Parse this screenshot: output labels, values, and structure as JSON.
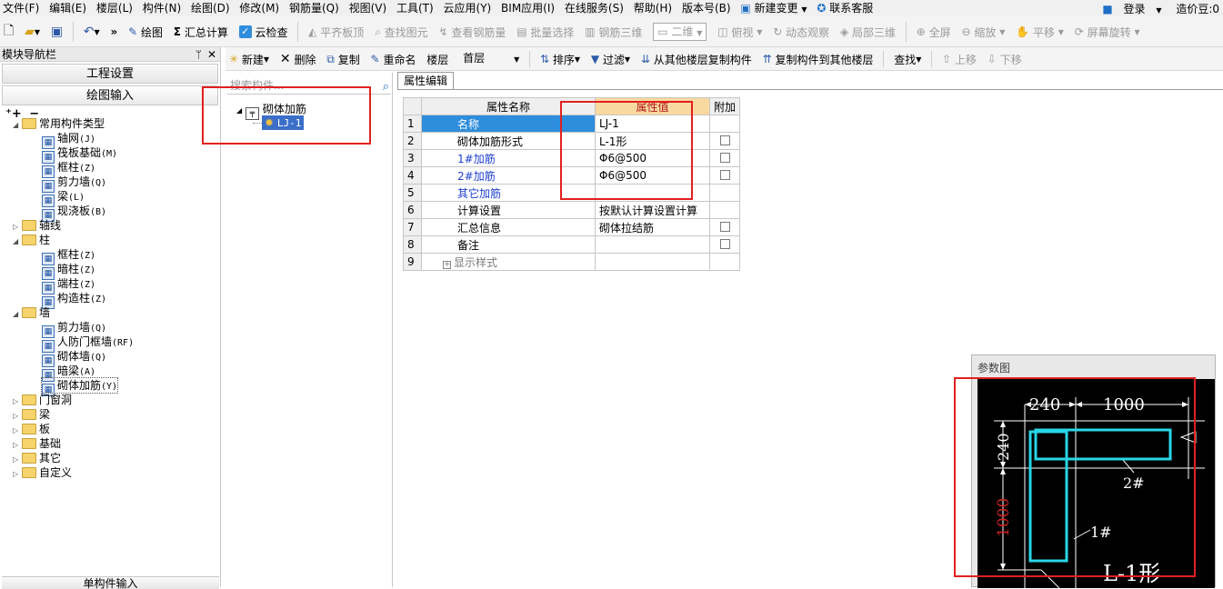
{
  "menubar": {
    "items": [
      "文件(F)",
      "编辑(E)",
      "楼层(L)",
      "构件(N)",
      "绘图(D)",
      "修改(M)",
      "钢筋量(Q)",
      "视图(V)",
      "工具(T)",
      "云应用(Y)",
      "BIM应用(I)",
      "在线服务(S)",
      "帮助(H)",
      "版本号(B)"
    ],
    "new_change": "新建变更",
    "contact": "联系客服",
    "login": "登录",
    "beans": "造价豆:0"
  },
  "toolbar": {
    "draw": "绘图",
    "sum_calc": "汇总计算",
    "cloud_check": "云检查",
    "align_slab_top": "平齐板顶",
    "find_element": "查找图元",
    "view_rebar": "查看钢筋量",
    "batch_select": "批量选择",
    "rebar_3d": "钢筋三维",
    "view_mode": "二维",
    "top_view": "俯视",
    "dynamic_view": "动态观察",
    "local_3d": "局部三维",
    "fullscreen": "全屏",
    "zoom": "缩放",
    "pan": "平移",
    "rotate": "屏幕旋转"
  },
  "nav": {
    "title": "模块导航栏",
    "project_settings": "工程设置",
    "drawing_input": "绘图输入",
    "single_input": "单构件输入",
    "tree": [
      {
        "label": "常用构件类型",
        "level": 0,
        "type": "folder",
        "open": true
      },
      {
        "label": "轴网",
        "hotkey": "(J)",
        "level": 1,
        "icon": "grid-icon"
      },
      {
        "label": "筏板基础",
        "hotkey": "(M)",
        "level": 1,
        "icon": "raft-icon"
      },
      {
        "label": "框柱",
        "hotkey": "(Z)",
        "level": 1,
        "icon": "column-icon"
      },
      {
        "label": "剪力墙",
        "hotkey": "(Q)",
        "level": 1,
        "icon": "shear-wall-icon"
      },
      {
        "label": "梁",
        "hotkey": "(L)",
        "level": 1,
        "icon": "beam-icon"
      },
      {
        "label": "现浇板",
        "hotkey": "(B)",
        "level": 1,
        "icon": "slab-icon"
      },
      {
        "label": "轴线",
        "level": 0,
        "type": "folder",
        "open": false
      },
      {
        "label": "柱",
        "level": 0,
        "type": "folder",
        "open": true
      },
      {
        "label": "框柱",
        "hotkey": "(Z)",
        "level": 1,
        "icon": "column-icon"
      },
      {
        "label": "暗柱",
        "hotkey": "(Z)",
        "level": 1,
        "icon": "column-icon"
      },
      {
        "label": "端柱",
        "hotkey": "(Z)",
        "level": 1,
        "icon": "column-icon"
      },
      {
        "label": "构造柱",
        "hotkey": "(Z)",
        "level": 1,
        "icon": "construct-column-icon"
      },
      {
        "label": "墙",
        "level": 0,
        "type": "folder",
        "open": true
      },
      {
        "label": "剪力墙",
        "hotkey": "(Q)",
        "level": 1,
        "icon": "shear-wall-icon"
      },
      {
        "label": "人防门框墙",
        "hotkey": "(RF)",
        "level": 1,
        "icon": "door-frame-wall-icon"
      },
      {
        "label": "砌体墙",
        "hotkey": "(Q)",
        "level": 1,
        "icon": "masonry-wall-icon"
      },
      {
        "label": "暗梁",
        "hotkey": "(A)",
        "level": 1,
        "icon": "hidden-beam-icon"
      },
      {
        "label": "砌体加筋",
        "hotkey": "(Y)",
        "level": 1,
        "icon": "masonry-rebar-icon",
        "selected": true
      },
      {
        "label": "门窗洞",
        "level": 0,
        "type": "folder",
        "open": false
      },
      {
        "label": "梁",
        "level": 0,
        "type": "folder",
        "open": false
      },
      {
        "label": "板",
        "level": 0,
        "type": "folder",
        "open": false
      },
      {
        "label": "基础",
        "level": 0,
        "type": "folder",
        "open": false
      },
      {
        "label": "其它",
        "level": 0,
        "type": "folder",
        "open": false
      },
      {
        "label": "自定义",
        "level": 0,
        "type": "folder",
        "open": false
      }
    ]
  },
  "toolbar2": {
    "new": "新建",
    "delete": "删除",
    "copy": "复制",
    "rename": "重命名",
    "floor_label": "楼层",
    "floor_value": "首层",
    "sort": "排序",
    "filter": "过滤",
    "copy_from_floor": "从其他楼层复制构件",
    "copy_to_floor": "复制构件到其他楼层",
    "find": "查找",
    "move_up": "上移",
    "move_down": "下移"
  },
  "components": {
    "search_placeholder": "搜索构件...",
    "root": "砌体加筋",
    "child": "LJ-1"
  },
  "properties": {
    "tab": "属性编辑",
    "headers": [
      "属性名称",
      "属性值",
      "附加"
    ],
    "rows": [
      {
        "num": "1",
        "name": "名称",
        "value": "LJ-1",
        "checkbox": false,
        "blue": false
      },
      {
        "num": "2",
        "name": "砌体加筋形式",
        "value": "L-1形",
        "checkbox": true,
        "blue": false
      },
      {
        "num": "3",
        "name": "1#加筋",
        "value": "Φ6@500",
        "checkbox": true,
        "blue": true
      },
      {
        "num": "4",
        "name": "2#加筋",
        "value": "Φ6@500",
        "checkbox": true,
        "blue": true
      },
      {
        "num": "5",
        "name": "其它加筋",
        "value": "",
        "checkbox": false,
        "blue": true
      },
      {
        "num": "6",
        "name": "计算设置",
        "value": "按默认计算设置计算",
        "checkbox": false,
        "blue": false
      },
      {
        "num": "7",
        "name": "汇总信息",
        "value": "砌体拉结筋",
        "checkbox": true,
        "blue": false
      },
      {
        "num": "8",
        "name": "备注",
        "value": "",
        "checkbox": true,
        "blue": false
      },
      {
        "num": "9",
        "name": "显示样式",
        "value": "",
        "checkbox": false,
        "blue": false,
        "expandable": true
      }
    ]
  },
  "param_diagram": {
    "title": "参数图",
    "dim_top_left": "240",
    "dim_top_right": "1000",
    "dim_left_top": "240",
    "dim_left_bottom": "1000",
    "label_2": "2#",
    "label_1": "1#",
    "shape_label": "L-1形",
    "colors": {
      "rebar": "#28d6e6",
      "dim": "#ffffff",
      "dim_red": "#d22222",
      "background": "#000000"
    }
  },
  "colors": {
    "selection": "#2e8ddc",
    "annotation_red": "#e22020",
    "header_highlight": "#f8d9a0"
  }
}
